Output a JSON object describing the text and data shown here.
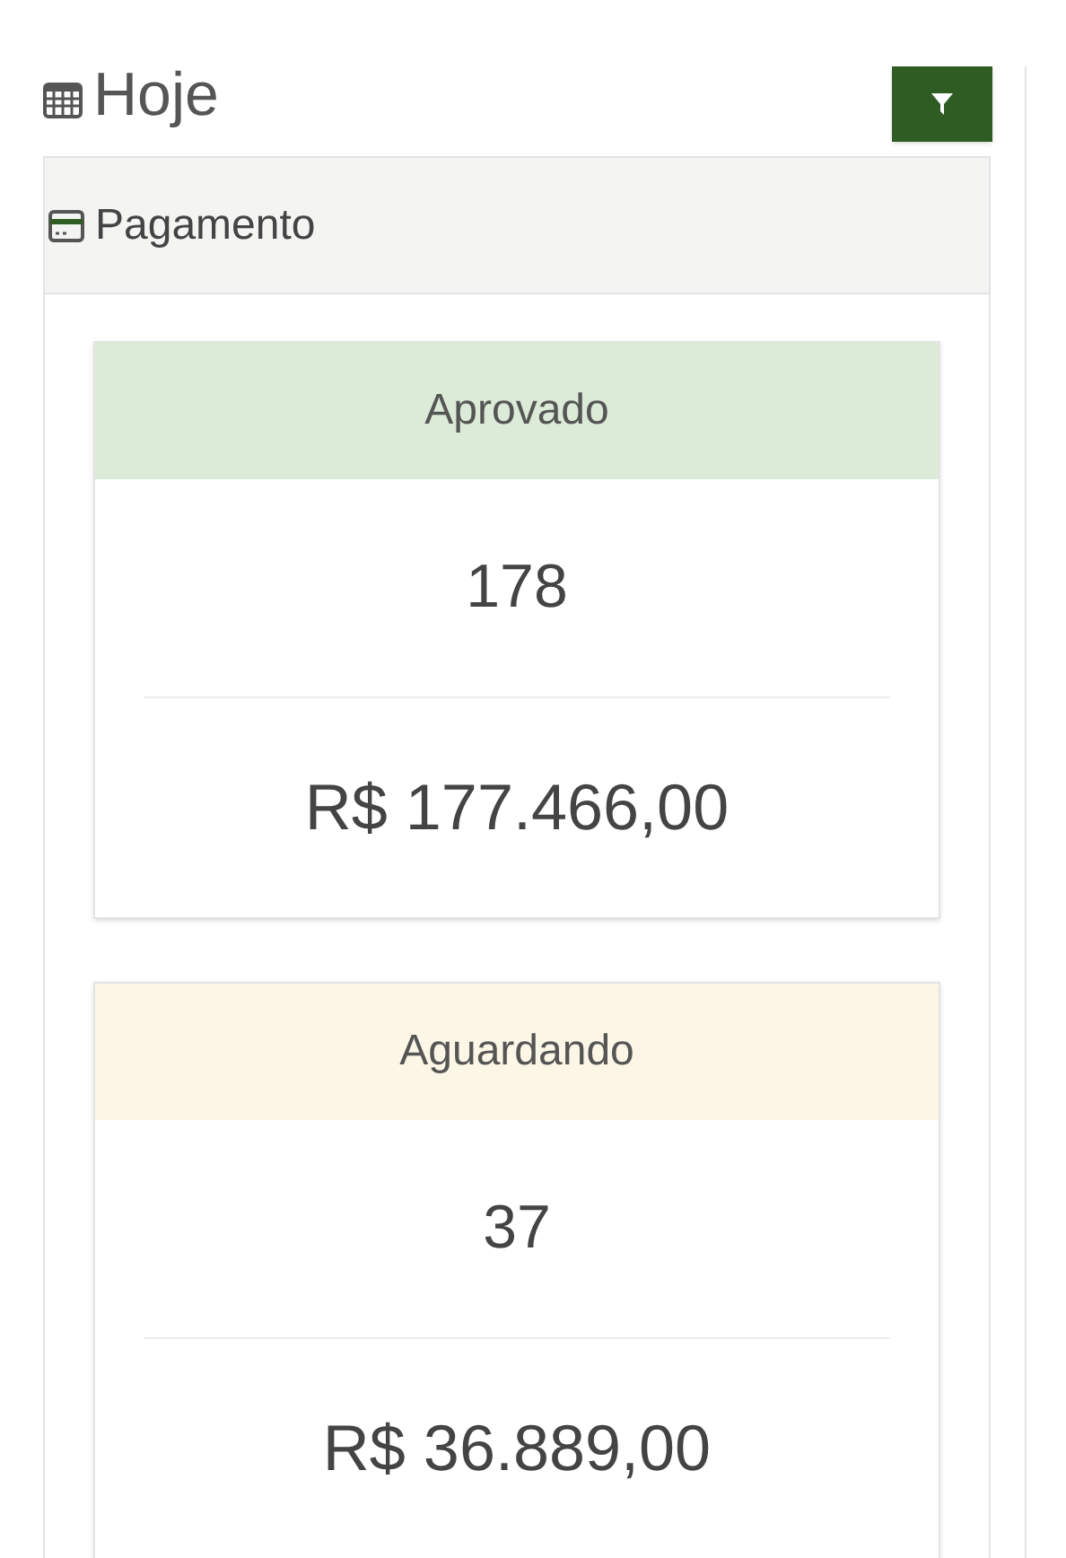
{
  "header": {
    "title": "Hoje"
  },
  "panel": {
    "title": "Pagamento"
  },
  "cards": [
    {
      "kind": "approved",
      "title": "Aprovado",
      "count": "178",
      "amount": "R$ 177.466,00"
    },
    {
      "kind": "waiting",
      "title": "Aguardando",
      "count": "37",
      "amount": "R$ 36.889,00"
    }
  ]
}
